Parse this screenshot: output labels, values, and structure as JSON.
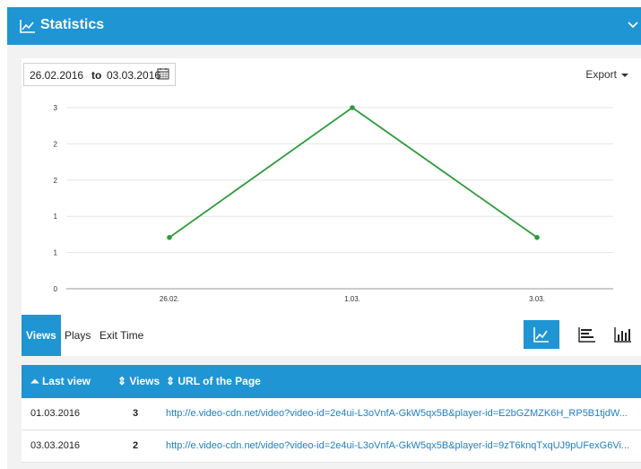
{
  "header": {
    "title": "Statistics"
  },
  "filters": {
    "date_from": "26.02.2016",
    "to_label": "to",
    "date_to": "03.03.2016",
    "export_label": "Export"
  },
  "chart_data": {
    "type": "line",
    "categories": [
      "26.02.",
      "1.03.",
      "3.03."
    ],
    "series": [
      {
        "values": [
          0.85,
          3,
          0.85
        ],
        "color": "#2e9b3a"
      }
    ],
    "ytick_labels": [
      "3",
      "2",
      "2",
      "1",
      "1",
      "0"
    ],
    "ylim": [
      0,
      3
    ],
    "grid": true,
    "xlabel": "",
    "ylabel": "",
    "title": ""
  },
  "tabs": [
    {
      "label": "Views",
      "active": true
    },
    {
      "label": "Plays",
      "active": false
    },
    {
      "label": "Exit Time",
      "active": false
    }
  ],
  "view_buttons": [
    {
      "icon": "line-chart-icon",
      "active": true
    },
    {
      "icon": "horizontal-bar-icon",
      "active": false
    },
    {
      "icon": "vertical-bar-icon",
      "active": false
    }
  ],
  "table": {
    "headers": {
      "last_view": "Last view",
      "views": "Views",
      "url": "URL of the Page"
    },
    "rows": [
      {
        "last_view": "01.03.2016",
        "views": "3",
        "url": "http://e.video-cdn.net/video?video-id=2e4ui-L3oVnfA-GkW5qx5B&player-id=E2bGZMZK6H_RP5B1tjdW..."
      },
      {
        "last_view": "03.03.2016",
        "views": "2",
        "url": "http://e.video-cdn.net/video?video-id=2e4ui-L3oVnfA-GkW5qx5B&player-id=9zT6knqTxqUJ9pUFexG6Vi..."
      }
    ]
  },
  "colors": {
    "accent": "#1f95d3",
    "line": "#2e9b3a",
    "link": "#1e7fc4"
  }
}
